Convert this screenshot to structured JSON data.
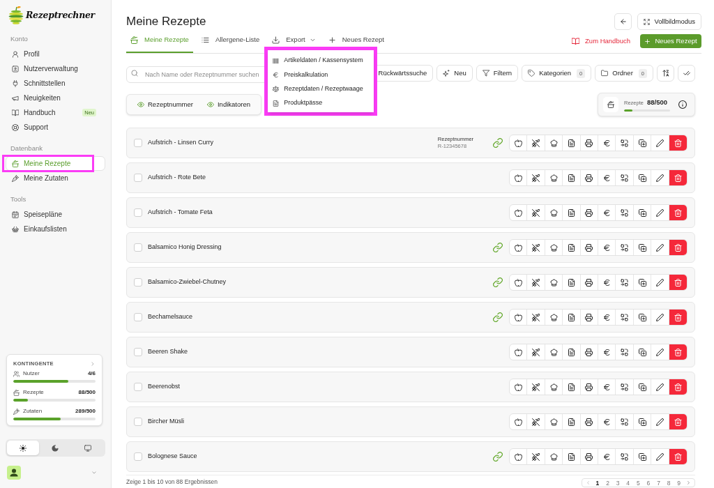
{
  "sidebar": {
    "brand": "Rezeptrechner",
    "sections": [
      {
        "title": "Konto",
        "items": [
          {
            "kind": "profile",
            "label": "Profil",
            "selected": false,
            "highlighted": false
          },
          {
            "kind": "users",
            "label": "Nutzerverwaltung",
            "selected": false,
            "highlighted": false
          },
          {
            "kind": "interfaces",
            "label": "Schnittstellen",
            "selected": false,
            "highlighted": false
          },
          {
            "kind": "news",
            "label": "Neuigkeiten",
            "selected": false,
            "highlighted": false
          },
          {
            "kind": "manual",
            "label": "Handbuch",
            "badge": "Neu",
            "selected": false,
            "highlighted": false
          },
          {
            "kind": "support",
            "label": "Support",
            "selected": false,
            "highlighted": false
          }
        ]
      },
      {
        "title": "Datenbank",
        "items": [
          {
            "kind": "recipes",
            "label": "Meine Rezepte",
            "selected": true,
            "highlighted": true
          },
          {
            "kind": "ingredients",
            "label": "Meine Zutaten",
            "selected": false,
            "highlighted": false
          }
        ]
      },
      {
        "title": "Tools",
        "items": [
          {
            "kind": "mealplans",
            "label": "Speisepläne",
            "selected": false,
            "highlighted": false
          },
          {
            "kind": "shopping",
            "label": "Einkaufslisten",
            "selected": false,
            "highlighted": false
          }
        ]
      }
    ],
    "quotas": {
      "title": "KONTINGENTE",
      "items": [
        {
          "kind": "users",
          "label": "Nutzer",
          "value": "4/6",
          "level": 0.667
        },
        {
          "kind": "recipes",
          "label": "Rezepte",
          "value": "88/500",
          "level": 0.176
        },
        {
          "kind": "ingredients",
          "label": "Zutaten",
          "value": "289/500",
          "level": 0.578
        }
      ]
    },
    "theme_options": [
      {
        "kind": "light",
        "selected": true
      },
      {
        "kind": "dark",
        "selected": false
      },
      {
        "kind": "system",
        "selected": false
      }
    ]
  },
  "header": {
    "title": "Meine Rezepte",
    "fullscreen_button": "Vollbildmodus",
    "manual_link": "Zum Handbuch",
    "new_button": "Neues Rezept"
  },
  "tabs": [
    {
      "kind": "recipes",
      "label": "Meine Rezepte",
      "selected": true
    },
    {
      "kind": "allergens",
      "label": "Allergene-Liste",
      "selected": false
    },
    {
      "kind": "export",
      "label": "Export",
      "selected": false
    },
    {
      "kind": "new",
      "label": "Neues Rezept",
      "selected": false
    }
  ],
  "export_menu": {
    "open": true,
    "highlighted": true,
    "items": [
      {
        "kind": "article",
        "label": "Artikeldaten / Kassensystem"
      },
      {
        "kind": "price",
        "label": "Preiskalkulation"
      },
      {
        "kind": "recipe_data",
        "label": "Rezeptdaten / Rezeptwaage"
      },
      {
        "kind": "passport",
        "label": "Produktpässe"
      }
    ]
  },
  "toolbar": {
    "search": {
      "placeholder": "Nach Name oder Rezeptnummer suchen"
    },
    "buttons": [
      {
        "kind": "reverse",
        "label": "Rückwärtssuche"
      },
      {
        "kind": "new",
        "label": "Neu"
      },
      {
        "kind": "filter",
        "label": "Filtern"
      },
      {
        "kind": "categories",
        "label": "Kategorien",
        "count": "0"
      },
      {
        "kind": "folders",
        "label": "Ordner",
        "count": "0"
      },
      {
        "kind": "sort"
      },
      {
        "kind": "select"
      }
    ]
  },
  "column_toggles": [
    {
      "label": "Rezeptnummer",
      "visible": true
    },
    {
      "label": "Indikatoren",
      "visible": true
    }
  ],
  "quota_summary": {
    "label": "Rezepte",
    "value": "88/500",
    "level": 0.176
  },
  "recipes": [
    {
      "name": "Aufstrich - Linsen Curry",
      "checked": false,
      "number_label": "Rezeptnummer",
      "number": "R-12345678",
      "linked": true
    },
    {
      "name": "Aufstrich - Rote Bete",
      "checked": false,
      "linked": false
    },
    {
      "name": "Aufstrich - Tomate Feta",
      "checked": false,
      "linked": false
    },
    {
      "name": "Balsamico Honig Dressing",
      "checked": false,
      "linked": true
    },
    {
      "name": "Balsamico-Zwiebel-Chutney",
      "checked": false,
      "linked": true
    },
    {
      "name": "Bechamelsauce",
      "checked": false,
      "linked": true
    },
    {
      "name": "Beeren Shake",
      "checked": false,
      "linked": false
    },
    {
      "name": "Beerenobst",
      "checked": false,
      "linked": false
    },
    {
      "name": "Bircher Müsli",
      "checked": false,
      "linked": false
    },
    {
      "name": "Bolognese Sauce",
      "checked": false,
      "linked": true
    }
  ],
  "footer": {
    "summary": "Zeige 1 bis 10 von 88 Ergebnissen",
    "pages": [
      {
        "label": "1",
        "selected": true
      },
      {
        "label": "2",
        "selected": false
      },
      {
        "label": "3",
        "selected": false
      },
      {
        "label": "4",
        "selected": false
      },
      {
        "label": "5",
        "selected": false
      },
      {
        "label": "6",
        "selected": false
      },
      {
        "label": "7",
        "selected": false
      },
      {
        "label": "8",
        "selected": false
      },
      {
        "label": "9",
        "selected": false
      }
    ]
  }
}
